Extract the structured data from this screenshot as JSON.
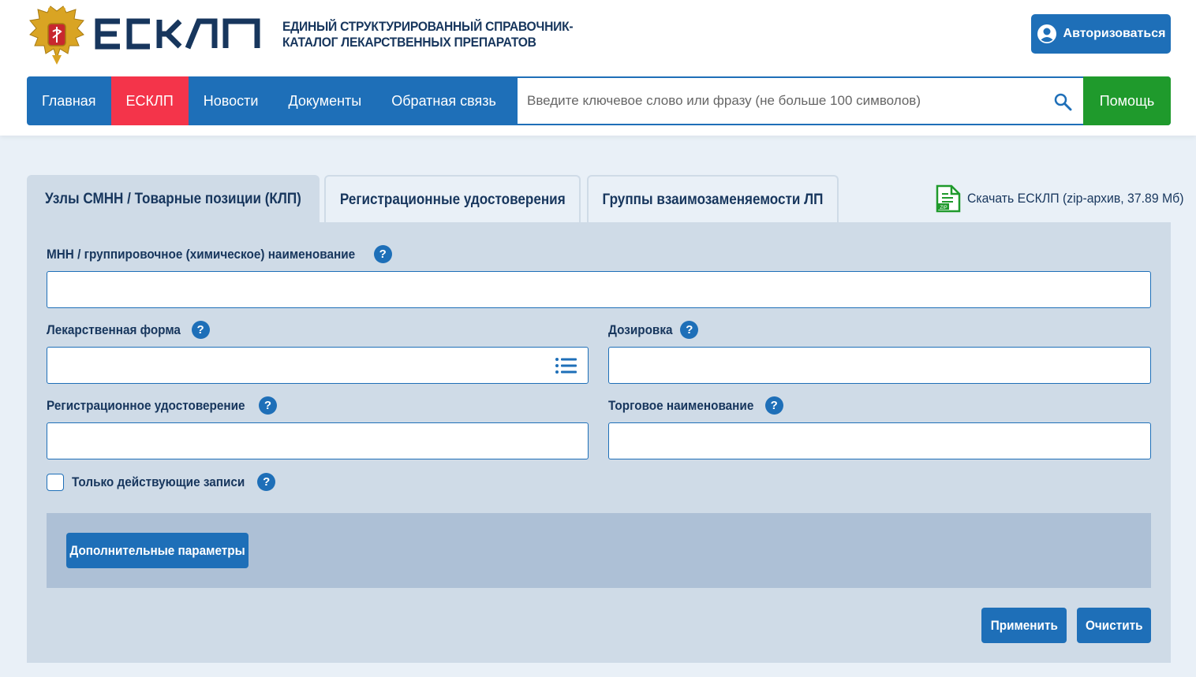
{
  "header": {
    "logo_text": "ЕСКЛП",
    "title_line1": "ЕДИНЫЙ СТРУКТУРИРОВАННЫЙ СПРАВОЧНИК-",
    "title_line2": "КАТАЛОГ ЛЕКАРСТВЕННЫХ ПРЕПАРАТОВ",
    "auth_label": "Авторизоваться"
  },
  "nav": {
    "items": [
      {
        "label": "Главная",
        "active": false
      },
      {
        "label": "ЕСКЛП",
        "active": true
      },
      {
        "label": "Новости",
        "active": false
      },
      {
        "label": "Документы",
        "active": false
      },
      {
        "label": "Обратная связь",
        "active": false
      }
    ],
    "search_placeholder": "Введите ключевое слово или фразу (не больше 100 символов)",
    "help_label": "Помощь"
  },
  "tabs": [
    {
      "label": "Узлы СМНН / Товарные позиции (КЛП)",
      "active": true
    },
    {
      "label": "Регистрационные удостоверения",
      "active": false
    },
    {
      "label": "Группы взаимозаменяемости ЛП",
      "active": false
    }
  ],
  "download": {
    "label": "Скачать ЕСКЛП (zip-архив, 37.89 Мб)",
    "icon_text": "ZIP"
  },
  "form": {
    "mnn_label": "МНН / группировочное (химическое) наименование",
    "mnn_value": "",
    "dosage_form_label": "Лекарственная форма",
    "dosage_form_value": "",
    "dosage_label": "Дозировка",
    "dosage_value": "",
    "reg_cert_label": "Регистрационное удостоверение",
    "reg_cert_value": "",
    "trade_name_label": "Торговое наименование",
    "trade_name_value": "",
    "active_only_label": "Только действующие записи",
    "help_mark": "?",
    "extra_params_label": "Дополнительные параметры",
    "apply_label": "Применить",
    "clear_label": "Очистить"
  },
  "colors": {
    "primary": "#1e6fb8",
    "active_nav": "#f4344a",
    "help_green": "#1f9a2c",
    "panel_bg": "#cfdbe7",
    "text_dark": "#17365d"
  }
}
